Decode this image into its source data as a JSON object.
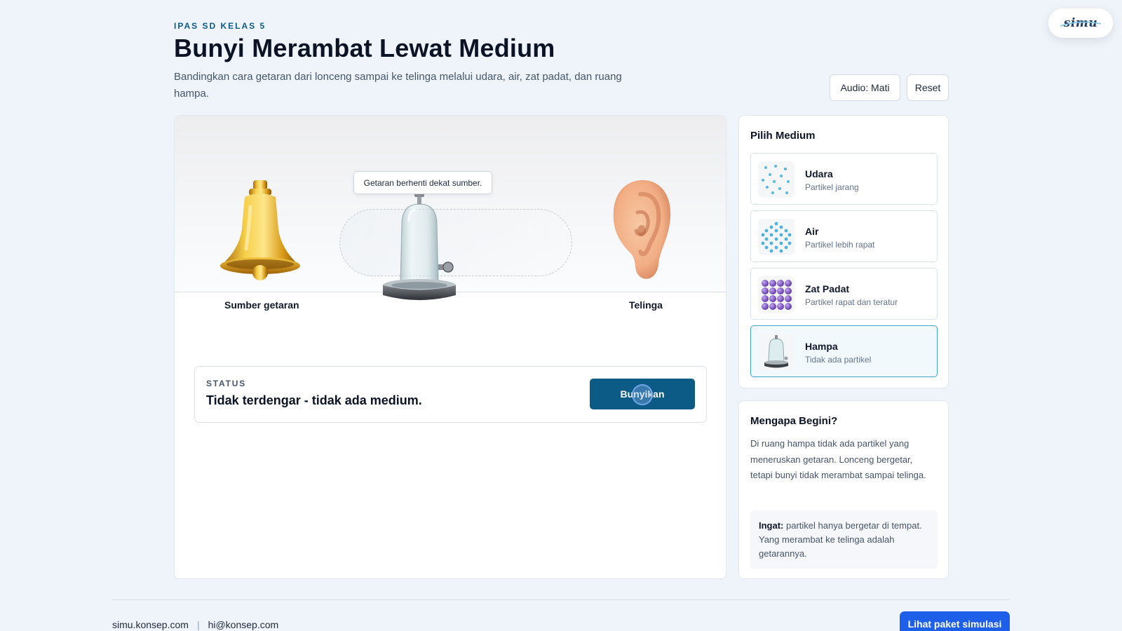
{
  "brand": {
    "logo_text": "simu"
  },
  "header": {
    "kicker": "IPAS SD KELAS 5",
    "title": "Bunyi Merambat Lewat Medium",
    "subtitle": "Bandingkan cara getaran dari lonceng sampai ke telinga melalui udara, air, zat padat, dan ruang hampa.",
    "audio_button": "Audio: Mati",
    "reset_button": "Reset"
  },
  "stage": {
    "tooltip": "Getaran berhenti dekat sumber.",
    "source_label": "Sumber getaran",
    "receiver_label": "Telinga",
    "icons": [
      "bell-icon",
      "bell-jar-icon",
      "ear-icon"
    ]
  },
  "status": {
    "label": "STATUS",
    "text": "Tidak terdengar - tidak ada medium.",
    "button": "Bunyikan"
  },
  "medium_panel": {
    "title": "Pilih Medium",
    "options": [
      {
        "name": "Udara",
        "desc": "Partikel jarang",
        "icon": "sparse-particles-icon",
        "selected": false
      },
      {
        "name": "Air",
        "desc": "Partikel lebih rapat",
        "icon": "dense-particles-icon",
        "selected": false
      },
      {
        "name": "Zat Padat",
        "desc": "Partikel rapat dan teratur",
        "icon": "solid-lattice-icon",
        "selected": false
      },
      {
        "name": "Hampa",
        "desc": "Tidak ada partikel",
        "icon": "bell-jar-icon",
        "selected": true
      }
    ]
  },
  "explain": {
    "title": "Mengapa Begini?",
    "text": "Di ruang hampa tidak ada partikel yang meneruskan getaran. Lonceng bergetar, tetapi bunyi tidak merambat sampai telinga.",
    "note_bold": "Ingat:",
    "note_text": " partikel hanya bergetar di tempat. Yang merambat ke telinga adalah getarannya."
  },
  "footer": {
    "site": "simu.konsep.com",
    "separator": "|",
    "email": "hi@konsep.com",
    "cta": "Lihat paket simulasi"
  },
  "colors": {
    "accent": "#0c5b86",
    "cta": "#1d5fe8",
    "selected_border": "#3fa6c7",
    "background": "#eef4fa"
  }
}
